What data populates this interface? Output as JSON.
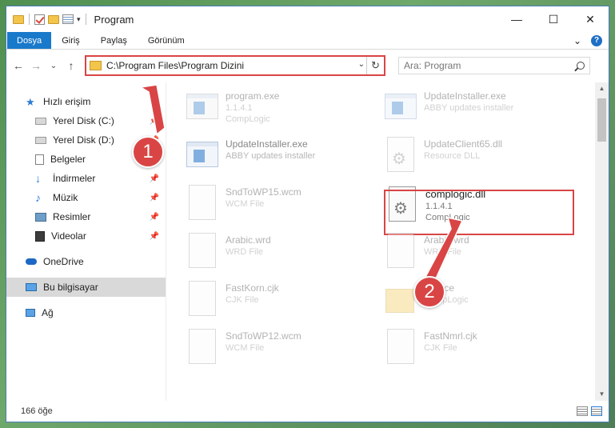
{
  "window": {
    "title": "Program",
    "controls": {
      "minimize": "—",
      "maximize": "☐",
      "close": "✕"
    }
  },
  "ribbon": {
    "tabs": [
      {
        "label": "Dosya"
      },
      {
        "label": "Giriş"
      },
      {
        "label": "Paylaş"
      },
      {
        "label": "Görünüm"
      }
    ],
    "expand": "⌄",
    "help": "?"
  },
  "address": {
    "path": "C:\\Program Files\\Program Dizini",
    "back": "←",
    "forward": "→",
    "recent": "⌄",
    "up": "↑",
    "dropdown": "⌄",
    "refresh": "↻"
  },
  "search": {
    "placeholder": "Ara: Program"
  },
  "sidebar": {
    "quick_access": "Hızlı erişim",
    "items": [
      {
        "label": "Yerel Disk (C:)",
        "pinned": true
      },
      {
        "label": "Yerel Disk (D:)",
        "pinned": true
      },
      {
        "label": "Belgeler",
        "pinned": false
      },
      {
        "label": "İndirmeler",
        "pinned": true
      },
      {
        "label": "Müzik",
        "pinned": true
      },
      {
        "label": "Resimler",
        "pinned": true
      },
      {
        "label": "Videolar",
        "pinned": true
      }
    ],
    "onedrive": "OneDrive",
    "this_pc": "Bu bilgisayar",
    "network": "Ağ"
  },
  "files": [
    {
      "name": "program.exe",
      "line1": "1.1.4.1",
      "line2": "CompLogic",
      "icon": "exe-icon"
    },
    {
      "name": "UpdateInstaller.exe",
      "line1": "ABBY updates installer",
      "line2": "",
      "icon": "exe-icon"
    },
    {
      "name": "UpdateInstaller.exe",
      "line1": "ABBY updates installer",
      "line2": "",
      "icon": "exe-icon"
    },
    {
      "name": "UpdateClient65.dll",
      "line1": "Resource DLL",
      "line2": "",
      "icon": "dll-icon"
    },
    {
      "name": "SndToWP15.wcm",
      "line1": "WCM File",
      "line2": "",
      "icon": "file-icon"
    },
    {
      "name": "complogic.dll",
      "line1": "1.1.4.1",
      "line2": "CompLogic",
      "icon": "dll-icon"
    },
    {
      "name": "Arabic.wrd",
      "line1": "WRD File",
      "line2": "",
      "icon": "file-icon"
    },
    {
      "name": "Arabic.wrd",
      "line1": "WRD File",
      "line2": "",
      "icon": "file-icon"
    },
    {
      "name": "FastKorn.cjk",
      "line1": "CJK File",
      "line2": "",
      "icon": "file-icon"
    },
    {
      "name": "Source",
      "line1": "",
      "line2": "CompLogic",
      "icon": "folder-icon"
    },
    {
      "name": "SndToWP12.wcm",
      "line1": "WCM File",
      "line2": "",
      "icon": "file-icon"
    },
    {
      "name": "FastNmrl.cjk",
      "line1": "CJK File",
      "line2": "",
      "icon": "file-icon"
    }
  ],
  "status": {
    "count": "166 öğe"
  },
  "markers": [
    "1",
    "2"
  ],
  "colors": {
    "accent": "#1979ca",
    "highlight": "#d94545"
  }
}
